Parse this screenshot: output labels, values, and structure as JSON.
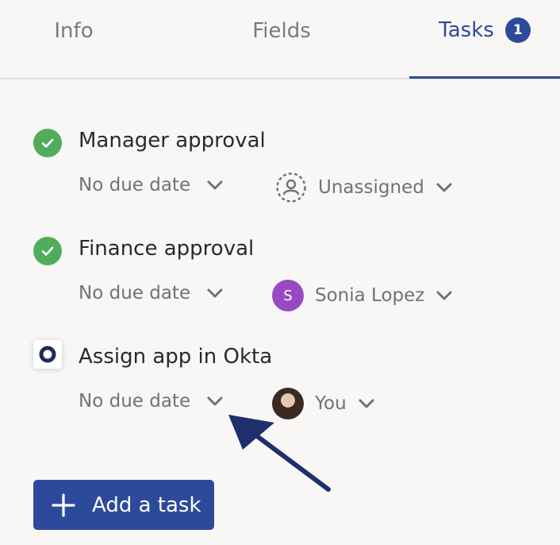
{
  "tabs": {
    "info": "Info",
    "fields": "Fields",
    "tasks": "Tasks",
    "tasks_badge": "1"
  },
  "tasks": [
    {
      "title": "Manager approval",
      "status": "completed",
      "due": "No due date",
      "assignee": "Unassigned",
      "assignee_type": "unassigned"
    },
    {
      "title": "Finance approval",
      "status": "completed",
      "due": "No due date",
      "assignee": "Sonia Lopez",
      "assignee_initial": "S",
      "assignee_type": "initial"
    },
    {
      "title": "Assign app in Okta",
      "status": "pending",
      "due": "No due date",
      "assignee": "You",
      "assignee_type": "photo"
    }
  ],
  "add_task": {
    "label": "Add a task"
  },
  "colors": {
    "accent": "#2d4a9a",
    "done_green": "#4fad5b",
    "avatar_purple": "#9a49c2",
    "text_muted": "#74726f"
  }
}
